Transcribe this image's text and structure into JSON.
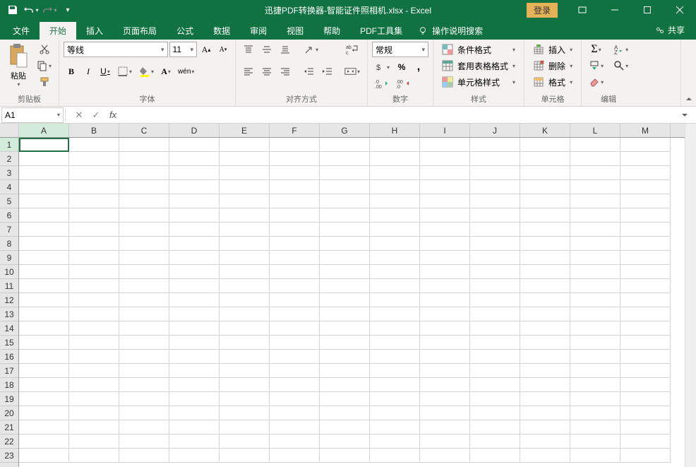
{
  "titlebar": {
    "title": "迅捷PDF转换器-智能证件照相机.xlsx - Excel",
    "signin": "登录"
  },
  "tabs": {
    "file": "文件",
    "home": "开始",
    "insert": "插入",
    "layout": "页面布局",
    "formula": "公式",
    "data": "数据",
    "review": "审阅",
    "view": "视图",
    "help": "帮助",
    "pdf": "PDF工具集",
    "tellme": "操作说明搜索"
  },
  "share": "共享",
  "groups": {
    "clipboard": "剪贴板",
    "font": "字体",
    "align": "对齐方式",
    "number": "数字",
    "styles": "样式",
    "cells": "单元格",
    "editing": "编辑"
  },
  "clipboard": {
    "paste": "粘贴"
  },
  "font": {
    "name": "等线",
    "size": "11",
    "bold": "B",
    "italic": "I",
    "underline": "U",
    "phonetic": "wén"
  },
  "number": {
    "format": "常规"
  },
  "styles": {
    "cond": "条件格式",
    "table": "套用表格格式",
    "cell": "单元格样式"
  },
  "cells": {
    "insert": "插入",
    "delete": "删除",
    "format": "格式"
  },
  "namebox": "A1",
  "columns": [
    "A",
    "B",
    "C",
    "D",
    "E",
    "F",
    "G",
    "H",
    "I",
    "J",
    "K",
    "L",
    "M"
  ],
  "rowcount": 23
}
